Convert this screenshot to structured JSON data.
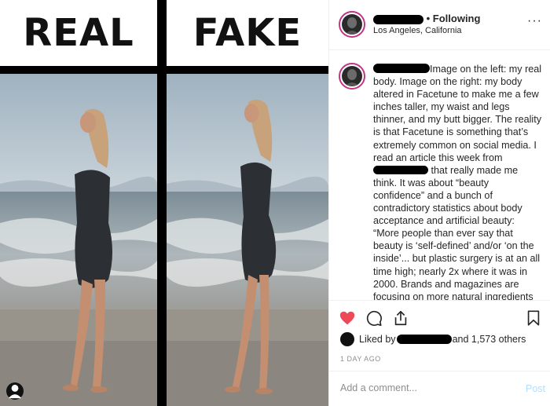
{
  "labels": {
    "left": "REAL",
    "right": "FAKE"
  },
  "header": {
    "status": "• Following",
    "location": "Los Angeles, California",
    "more_icon": "more-horizontal-icon"
  },
  "caption": {
    "part1": "Image on the left: my real body. Image on the right: my body altered in Facetune to make me a few inches taller, my waist and legs thinner, and my butt bigger. The reality is that Facetune is something that’s extremely common on social media. I read an article this week from ",
    "part2": " that really made me think. It was about “beauty confidence” and a bunch of contradictory statistics about body acceptance and artificial beauty: “More people than ever say that beauty is ‘self-defined’ and/or ‘on the inside’... but plastic surgery is at an all time high; nearly 2x where it was in 2000. Brands and magazines are focusing on more natural ingredients and authentic looks... but Facetuning, photo editing,"
  },
  "likes": {
    "prefix": "Liked by",
    "suffix": "and 1,573 others"
  },
  "timestamp": "1 DAY AGO",
  "comment": {
    "placeholder": "Add a comment...",
    "post_label": "Post"
  },
  "colors": {
    "like_red": "#ed4956",
    "post_disabled": "#b2dffc",
    "story_ring": "#c13584"
  }
}
